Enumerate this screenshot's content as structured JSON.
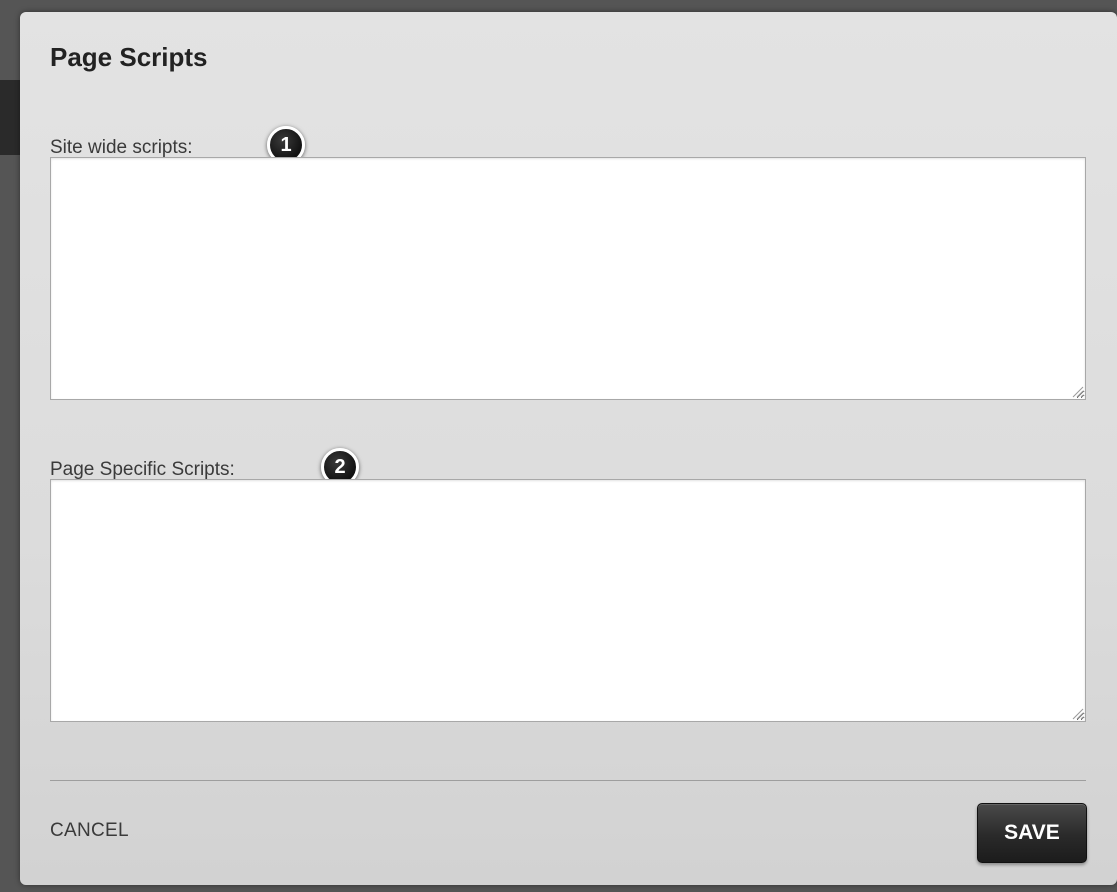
{
  "dialog": {
    "title": "Page Scripts"
  },
  "fields": [
    {
      "label": "Site wide scripts:",
      "badge": "1",
      "value": ""
    },
    {
      "label": "Page Specific Scripts:",
      "badge": "2",
      "value": ""
    }
  ],
  "actions": {
    "cancel_label": "CANCEL",
    "save_label": "SAVE"
  },
  "colors": {
    "dialog_background": "#dcdcdc",
    "save_button": "#2a2a2a",
    "badge": "#111111"
  }
}
